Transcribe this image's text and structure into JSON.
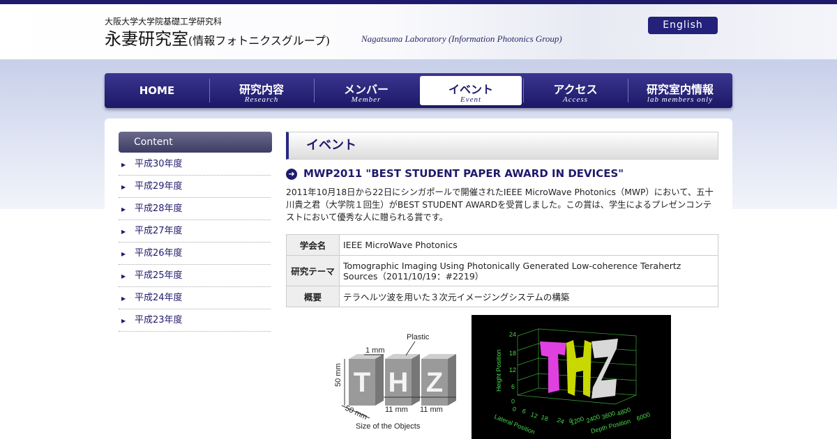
{
  "header": {
    "university": "大阪大学大学院基礎工学研究科",
    "lab_name": "永妻研究室",
    "lab_sub": "(情報フォトニクスグループ)",
    "lab_name_en": "Nagatsuma Laboratory (Information Photonics Group)",
    "english_button": "English"
  },
  "nav": [
    {
      "jp": "HOME",
      "en": ""
    },
    {
      "jp": "研究内容",
      "en": "Research"
    },
    {
      "jp": "メンバー",
      "en": "Member"
    },
    {
      "jp": "イベント",
      "en": "Event"
    },
    {
      "jp": "アクセス",
      "en": "Access"
    },
    {
      "jp": "研究室内情報",
      "en": "lab members only"
    }
  ],
  "sidebar": {
    "heading": "Content",
    "items": [
      "平成30年度",
      "平成29年度",
      "平成28年度",
      "平成27年度",
      "平成26年度",
      "平成25年度",
      "平成24年度",
      "平成23年度"
    ]
  },
  "page_heading": "イベント",
  "post": {
    "title": "MWP2011 \"BEST STUDENT PAPER AWARD IN DEVICES\"",
    "body": "2011年10月18日から22日にシンガポールで開催されたIEEE MicroWave Photonics（MWP）において、五十川貴之君（大学院１回生）がBEST STUDENT AWARDを受賞しました。この賞は、学生によるプレゼンコンテストにおいて優秀な人に贈られる賞です。",
    "table": [
      {
        "key": "学会名",
        "value": "IEEE MicroWave Photonics"
      },
      {
        "key": "研究テーマ",
        "value": "Tomographic Imaging Using Photonically Generated Low-coherence Terahertz Sources（2011/10/19：#2219）"
      },
      {
        "key": "概要",
        "value": "テラヘルツ波を用いた３次元イメージングシステムの構築"
      }
    ]
  },
  "figure_left": {
    "letters": [
      "T",
      "H",
      "Z"
    ],
    "plastic": "Plastic",
    "thickness": "1 mm",
    "height": "50 mm",
    "depth": "50 mm",
    "gap1": "11 mm",
    "gap2": "11 mm",
    "caption": "Size of the Objects"
  },
  "figure_right": {
    "y_label": "Height Position",
    "y_ticks": [
      "24",
      "18",
      "12",
      "6",
      "0"
    ],
    "x_label": "Lateral Position",
    "x_ticks": [
      "0",
      "6",
      "12",
      "18",
      "24"
    ],
    "z_label": "Depth Position",
    "z_ticks": [
      "0",
      "1200",
      "2400",
      "3600",
      "4800",
      "6000"
    ],
    "colors": {
      "t": "#e040e0",
      "h": "#c8d800",
      "z": "#d8d8d8",
      "axis": "#4ad64a"
    }
  }
}
